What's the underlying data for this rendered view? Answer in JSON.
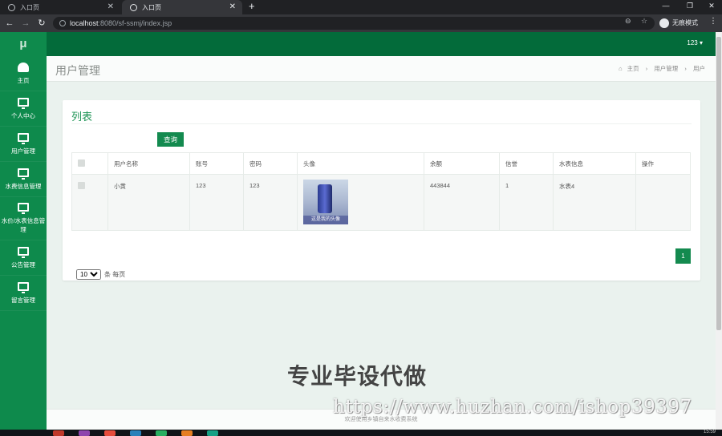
{
  "browser": {
    "tabs": [
      {
        "title": "入口页"
      },
      {
        "title": "入口页"
      }
    ],
    "new_tab": "+",
    "url_host": "localhost",
    "url_rest": ":8080/sf-ssmj/index.jsp",
    "incognito_label": "无痕模式"
  },
  "header": {
    "user": "123 ▾"
  },
  "sidebar": {
    "logo": "μ",
    "items": [
      {
        "label": "主页"
      },
      {
        "label": "个人中心"
      },
      {
        "label": "用户管理"
      },
      {
        "label": "水费信息管理"
      },
      {
        "label": "水价/水表信息管理"
      },
      {
        "label": "公告管理"
      },
      {
        "label": "留言管理"
      }
    ]
  },
  "page": {
    "title": "用户管理",
    "breadcrumb": [
      "主页",
      "用户管理",
      "用户"
    ],
    "home_icon": "home-icon"
  },
  "list": {
    "title": "列表",
    "search_placeholder": "",
    "search_button": "查询",
    "columns": [
      "用户名称",
      "账号",
      "密码",
      "头像",
      "余额",
      "信誉",
      "水表信息",
      "操作"
    ],
    "rows": [
      {
        "name": "小黄",
        "account": "123",
        "password": "123",
        "avatar_caption": "这是我的头像",
        "balance": "443844",
        "credit": "1",
        "meter": "水表4",
        "actions": ""
      }
    ],
    "page_size": "10",
    "page_size_suffix": "条 每页",
    "current_page": "1"
  },
  "watermark": {
    "text": "专业毕设代做",
    "url": "https://www.huzhan.com/ishop39397"
  },
  "footer": {
    "text": "欢迎使用乡镇自来水收费系统"
  },
  "taskbar": {
    "clock": "15:59"
  },
  "colors": {
    "sidebar": "#0e8a4c",
    "topbar": "#036b3a",
    "accent": "#138a4f",
    "title_green": "#1e9556"
  }
}
